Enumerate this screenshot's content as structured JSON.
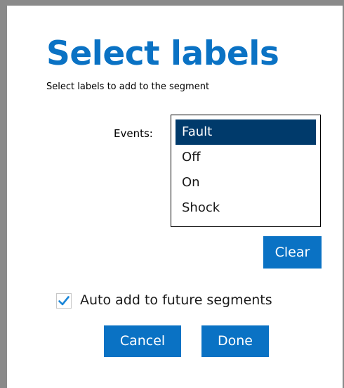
{
  "dialog": {
    "title": "Select labels",
    "subtitle": "Select labels to add to the segment"
  },
  "events": {
    "label": "Events:",
    "items": [
      "Fault",
      "Off",
      "On",
      "Shock"
    ],
    "selected": "Fault"
  },
  "buttons": {
    "clear": "Clear",
    "cancel": "Cancel",
    "done": "Done"
  },
  "auto_add": {
    "label": "Auto add to future segments",
    "checked": true
  },
  "colors": {
    "accent": "#0a72c4",
    "selection": "#003a6b",
    "check": "#1a86d8"
  }
}
